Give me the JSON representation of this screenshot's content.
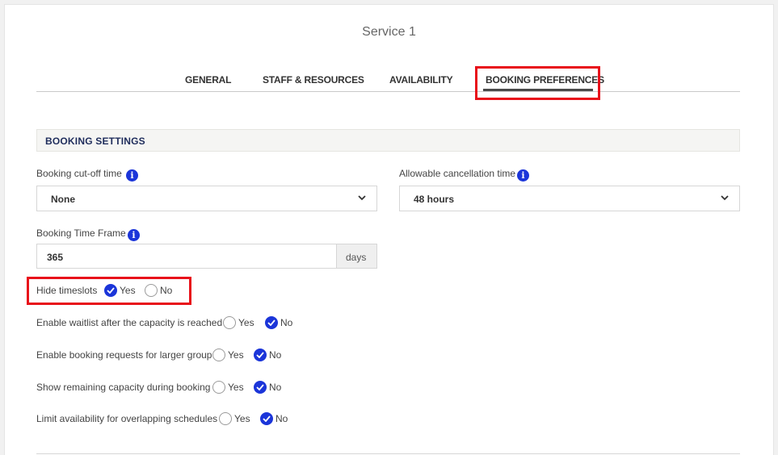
{
  "page": {
    "title": "Service 1"
  },
  "tabs": [
    {
      "label": "GENERAL",
      "active": false
    },
    {
      "label": "STAFF & RESOURCES",
      "active": false
    },
    {
      "label": "AVAILABILITY",
      "active": false
    },
    {
      "label": "BOOKING PREFERENCES",
      "active": true
    }
  ],
  "section": {
    "title": "BOOKING SETTINGS"
  },
  "fields": {
    "cutoff": {
      "label": "Booking cut-off time",
      "value": "None"
    },
    "cancellation": {
      "label": "Allowable cancellation time",
      "value": "48 hours"
    },
    "timeframe": {
      "label": "Booking Time Frame",
      "value": "365",
      "unit": "days"
    }
  },
  "toggles": [
    {
      "question": "Hide timeslots",
      "yes": "Yes",
      "no": "No",
      "selected": "yes"
    },
    {
      "question": "Enable waitlist after the capacity is reached",
      "yes": "Yes",
      "no": "No",
      "selected": "no"
    },
    {
      "question": "Enable booking requests for larger group",
      "yes": "Yes",
      "no": "No",
      "selected": "no"
    },
    {
      "question": "Show remaining capacity during booking",
      "yes": "Yes",
      "no": "No",
      "selected": "no"
    },
    {
      "question": "Limit availability for overlapping schedules",
      "yes": "Yes",
      "no": "No",
      "selected": "no"
    }
  ],
  "colors": {
    "accent": "#1b35d9",
    "highlight": "#e8101a"
  }
}
